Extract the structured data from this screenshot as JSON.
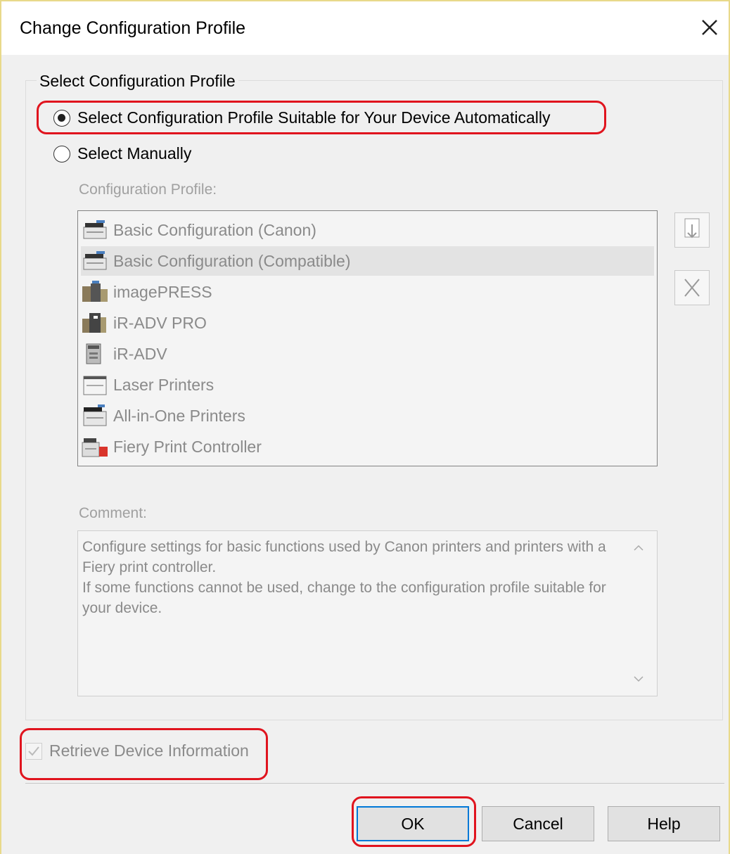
{
  "window": {
    "title": "Change Configuration Profile"
  },
  "group": {
    "label": "Select Configuration Profile"
  },
  "radios": {
    "auto_label": "Select Configuration Profile Suitable for Your Device Automatically",
    "manual_label": "Select Manually",
    "selected": "auto"
  },
  "profile_list": {
    "label": "Configuration Profile:",
    "items": [
      {
        "label": "Basic Configuration (Canon)",
        "icon": "printer-icon"
      },
      {
        "label": "Basic Configuration (Compatible)",
        "icon": "printer-icon"
      },
      {
        "label": "imagePRESS",
        "icon": "production-printer-icon"
      },
      {
        "label": "iR-ADV PRO",
        "icon": "production-printer-icon"
      },
      {
        "label": "iR-ADV",
        "icon": "multifunction-printer-icon"
      },
      {
        "label": "Laser Printers",
        "icon": "laser-printer-icon"
      },
      {
        "label": "All-in-One Printers",
        "icon": "all-in-one-printer-icon"
      },
      {
        "label": "Fiery Print Controller",
        "icon": "fiery-controller-icon"
      }
    ],
    "selected_index": 1
  },
  "comment": {
    "label": "Comment:",
    "text_line1": "Configure settings for basic functions used by Canon printers and printers with a Fiery print controller.",
    "text_line2": "If some functions cannot be used, change to the configuration profile suitable for your device."
  },
  "checkbox": {
    "label": "Retrieve Device Information",
    "checked": true
  },
  "buttons": {
    "ok": "OK",
    "cancel": "Cancel",
    "help": "Help"
  },
  "colors": {
    "highlight": "#e0141e",
    "default_button_border": "#0078d7",
    "disabled_text": "#8a8a8a"
  }
}
